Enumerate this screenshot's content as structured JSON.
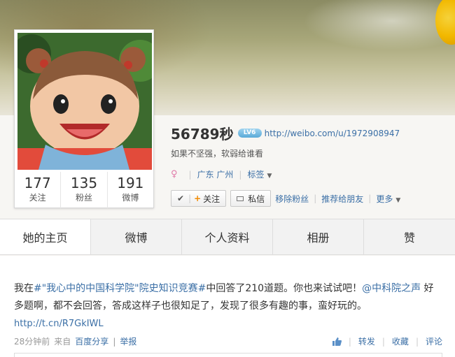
{
  "colors": {
    "link": "#3b6fa6",
    "accent_orange": "#f28a00",
    "female_pink": "#e07aa8"
  },
  "profile": {
    "name": "56789秒",
    "level_badge": "LV6",
    "home_url": "http://weibo.com/u/1972908947",
    "bio": "如果不坚强，软弱给谁看",
    "gender_icon": "female-icon",
    "location": "广东 广州",
    "tags_label": "标签"
  },
  "stats": [
    {
      "value": "177",
      "label": "关注"
    },
    {
      "value": "135",
      "label": "粉丝"
    },
    {
      "value": "191",
      "label": "微博"
    }
  ],
  "actions": {
    "follow_label": "关注",
    "message_label": "私信",
    "remove_fan": "移除粉丝",
    "recommend": "推荐给朋友",
    "more": "更多"
  },
  "tabs": [
    "她的主页",
    "微博",
    "个人资料",
    "相册",
    "赞"
  ],
  "post": {
    "text_part1": "我在",
    "hashtag": "#\"我心中的中国科学院\"院史知识竞赛#",
    "text_part2": "中回答了210道题。你也来试试吧！",
    "mention": "@中科院之声",
    "text_part3": " 好多题啊，都不会回答，答成这样子也很知足了，发现了很多有趣的事，蛮好玩的。",
    "short_link": "http://t.cn/R7GkIWL",
    "time": "28分钟前",
    "source_prefix": "来自",
    "source": "百度分享",
    "report": "举报",
    "repost": "转发",
    "favorite": "收藏",
    "comment": "评论"
  }
}
